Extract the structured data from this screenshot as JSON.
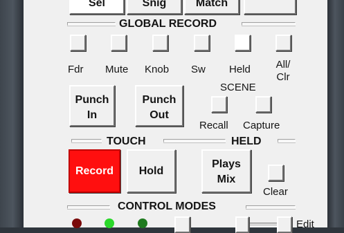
{
  "top_buttons": [
    {
      "label": "Sel"
    },
    {
      "label": "Snig"
    },
    {
      "label": "Match"
    },
    {
      "label": ""
    }
  ],
  "global_record": {
    "header": "GLOBAL RECORD",
    "items": [
      {
        "label": "Fdr"
      },
      {
        "label": "Mute"
      },
      {
        "label": "Knob"
      },
      {
        "label": "Sw"
      },
      {
        "label": "Held"
      },
      {
        "label_line1": "All/",
        "label_line2": "Clr"
      }
    ]
  },
  "punch": {
    "in": {
      "line1": "Punch",
      "line2": "In"
    },
    "out": {
      "line1": "Punch",
      "line2": "Out"
    }
  },
  "scene": {
    "header": "SCENE",
    "recall": "Recall",
    "capture": "Capture"
  },
  "touch_held": {
    "touch": "TOUCH",
    "held": "HELD"
  },
  "transport": {
    "record": "Record",
    "hold": "Hold",
    "plays_mix_line1": "Plays",
    "plays_mix_line2": "Mix",
    "clear": "Clear"
  },
  "control_modes": {
    "header": "CONTROL MODES",
    "edit": "Edit"
  },
  "colors": {
    "record_bg": "#ff0f0f",
    "led_dark_red": "#7a0a0a",
    "led_bright_green": "#2bd82b",
    "led_dark_green": "#1f7a1f"
  }
}
